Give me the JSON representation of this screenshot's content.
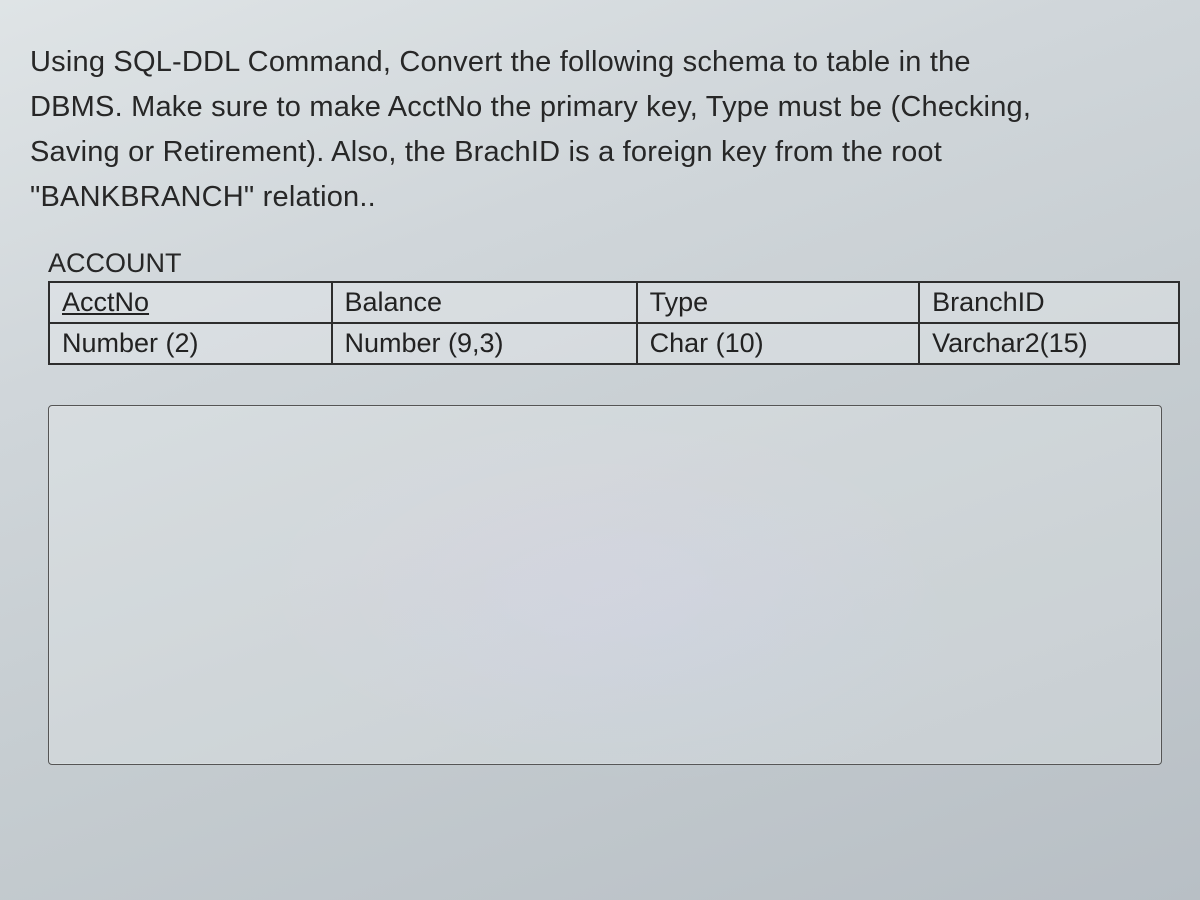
{
  "question": {
    "line1": "Using SQL-DDL Command, Convert the following schema to table in the",
    "line2": "DBMS. Make sure to make AcctNo the primary key, Type must be (Checking,",
    "line3": "Saving or Retirement). Also, the BrachID is a foreign key from the root",
    "line4": "\"BANKBRANCH\" relation.."
  },
  "schema": {
    "name": "ACCOUNT",
    "columns": [
      {
        "name": "AcctNo",
        "datatype": "Number (2)",
        "pk": true
      },
      {
        "name": "Balance",
        "datatype": "Number (9,3)",
        "pk": false
      },
      {
        "name": "Type",
        "datatype": "Char (10)",
        "pk": false
      },
      {
        "name": "BranchID",
        "datatype": "Varchar2(15)",
        "pk": false
      }
    ]
  },
  "answerbox": {
    "placeholder": ""
  }
}
